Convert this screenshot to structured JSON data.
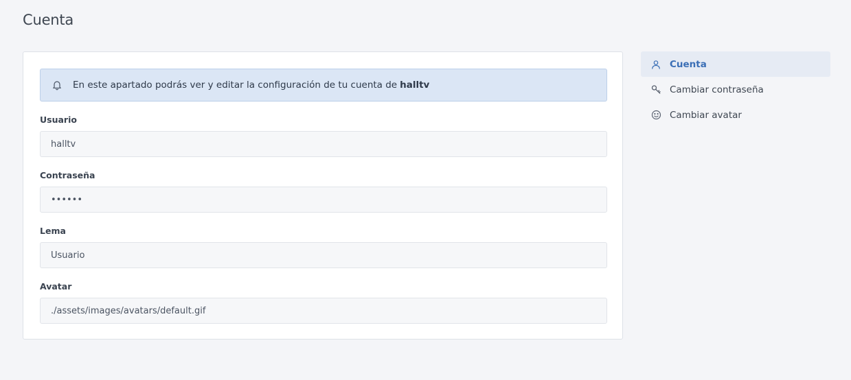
{
  "page": {
    "title": "Cuenta"
  },
  "alert": {
    "icon": "bell-icon",
    "text": "En este apartado podrás ver y editar la configuración de tu cuenta de",
    "username": "halltv"
  },
  "form": {
    "username": {
      "label": "Usuario",
      "value": "halltv"
    },
    "password": {
      "label": "Contraseña",
      "value": "••••••"
    },
    "motto": {
      "label": "Lema",
      "value": "Usuario"
    },
    "avatar": {
      "label": "Avatar",
      "value": "./assets/images/avatars/default.gif"
    }
  },
  "sidebar": {
    "items": [
      {
        "label": "Cuenta",
        "icon": "user-icon",
        "active": true
      },
      {
        "label": "Cambiar contraseña",
        "icon": "key-icon",
        "active": false
      },
      {
        "label": "Cambiar avatar",
        "icon": "smiley-icon",
        "active": false
      }
    ]
  },
  "colors": {
    "accent": "#3b6fb6",
    "alert_bg": "#dbe6f5",
    "page_bg": "#f4f5f8"
  }
}
